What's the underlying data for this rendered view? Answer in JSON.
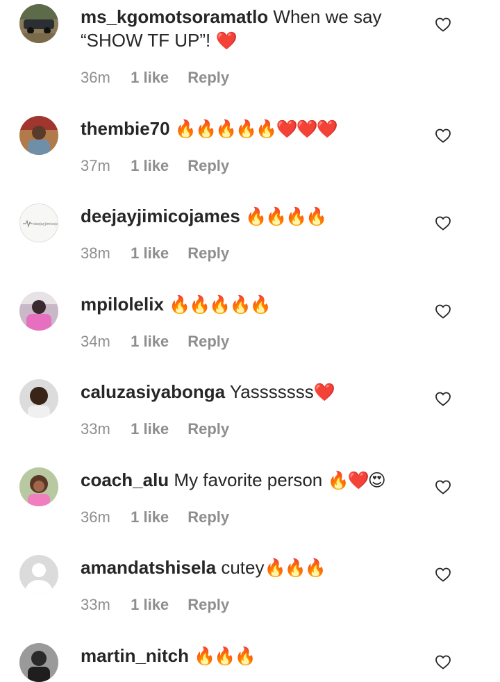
{
  "comments": [
    {
      "username": "ms_kgomotsoramatlo",
      "text": "When we say",
      "text_line2": "“SHOW TF UP”!",
      "emoji": "❤️",
      "time": "36m",
      "likes": "1 like",
      "reply": "Reply",
      "avatar": "car-photo-avatar"
    },
    {
      "username": "thembie70",
      "text": "",
      "emoji": "🔥🔥🔥🔥🔥❤️❤️❤️",
      "time": "37m",
      "likes": "1 like",
      "reply": "Reply",
      "avatar": "person-photo-avatar"
    },
    {
      "username": "deejayjimicojames",
      "text": "",
      "emoji": "🔥🔥🔥🔥",
      "time": "38m",
      "likes": "1 like",
      "reply": "Reply",
      "avatar": "logo-avatar",
      "avatar_text": "deejayjimicojames"
    },
    {
      "username": "mpilolelix",
      "text": "",
      "emoji": "🔥🔥🔥🔥🔥",
      "time": "34m",
      "likes": "1 like",
      "reply": "Reply",
      "avatar": "person-photo-avatar"
    },
    {
      "username": "caluzasiyabonga",
      "text": "Yasssssss",
      "emoji": "❤️",
      "time": "33m",
      "likes": "1 like",
      "reply": "Reply",
      "avatar": "person-photo-avatar"
    },
    {
      "username": "coach_alu",
      "text": "My favorite person",
      "emoji": "🔥❤️😍",
      "time": "36m",
      "likes": "1 like",
      "reply": "Reply",
      "avatar": "person-photo-avatar"
    },
    {
      "username": "amandatshisela",
      "text": "cutey",
      "emoji": "🔥🔥🔥",
      "time": "33m",
      "likes": "1 like",
      "reply": "Reply",
      "avatar": "default-avatar"
    },
    {
      "username": "martin_nitch",
      "text": "",
      "emoji": "🔥🔥🔥",
      "time": "",
      "likes": "",
      "reply": "",
      "avatar": "person-photo-avatar"
    }
  ],
  "colors": {
    "primary_text": "#262626",
    "secondary_text": "#8e8e8e",
    "heart_outline": "#262626",
    "background": "#ffffff"
  },
  "icons": {
    "like": "heart-outline-icon"
  }
}
